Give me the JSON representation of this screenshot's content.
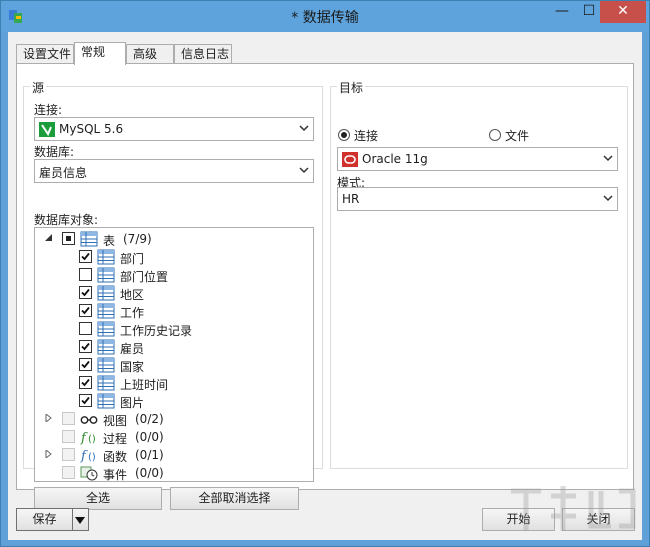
{
  "window": {
    "title": "* 数据传输",
    "min": "—",
    "max": "☐",
    "close": "✕"
  },
  "tabs": [
    {
      "label": "设置文件"
    },
    {
      "label": "常规"
    },
    {
      "label": "高级"
    },
    {
      "label": "信息日志"
    }
  ],
  "source": {
    "group_label": "源",
    "connection_label": "连接:",
    "connection_value": "MySQL 5.6",
    "database_label": "数据库:",
    "database_value": "雇员信息",
    "objects_label": "数据库对象:",
    "tree": {
      "tables": {
        "label": "表",
        "count": "(7/9)"
      },
      "table_items": [
        {
          "label": "部门",
          "checked": true
        },
        {
          "label": "部门位置",
          "checked": false
        },
        {
          "label": "地区",
          "checked": true
        },
        {
          "label": "工作",
          "checked": true
        },
        {
          "label": "工作历史记录",
          "checked": false
        },
        {
          "label": "雇员",
          "checked": true
        },
        {
          "label": "国家",
          "checked": true
        },
        {
          "label": "上班时间",
          "checked": true
        },
        {
          "label": "图片",
          "checked": true
        }
      ],
      "views": {
        "label": "视图",
        "count": "(0/2)"
      },
      "procedures": {
        "label": "过程",
        "count": "(0/0)"
      },
      "functions": {
        "label": "函数",
        "count": "(0/1)"
      },
      "events": {
        "label": "事件",
        "count": "(0/0)"
      }
    },
    "select_all": "全选",
    "deselect_all": "全部取消选择"
  },
  "target": {
    "group_label": "目标",
    "radio_connection": "连接",
    "radio_file": "文件",
    "selected": "connection",
    "connection_value": "Oracle 11g",
    "schema_label": "模式:",
    "schema_value": "HR"
  },
  "footer": {
    "save": "保存",
    "start": "开始",
    "close": "关闭"
  },
  "colors": {
    "mysql": "#1a9d3a",
    "oracle": "#d0312d",
    "close_button": "#c7514a",
    "table_icon": "#2f6fb5"
  }
}
